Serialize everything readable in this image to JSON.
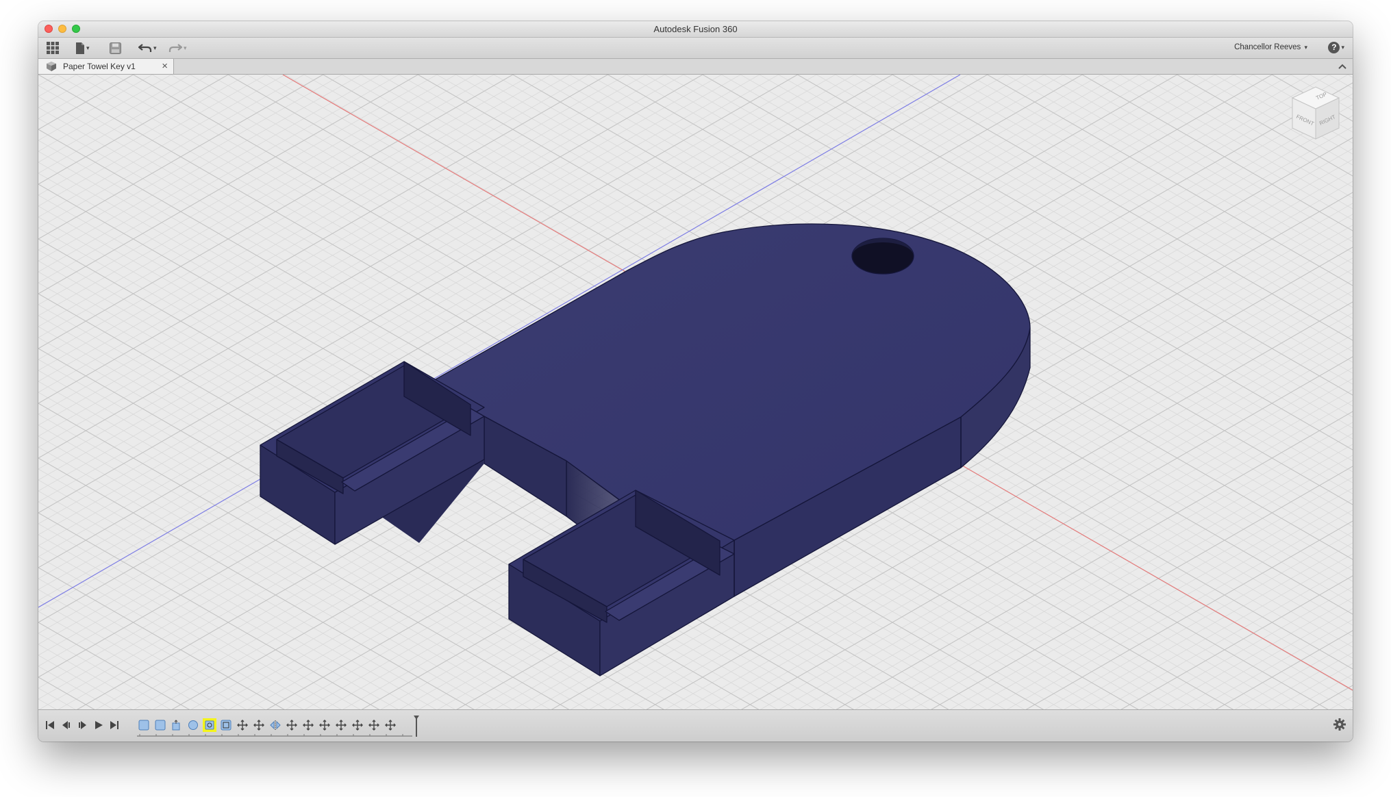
{
  "window": {
    "title": "Autodesk Fusion 360"
  },
  "toolbar": {
    "user_name": "Chancellor Reeves"
  },
  "document_tab": {
    "label": "Paper Towel Key v1",
    "close_glyph": "×"
  },
  "help": {
    "glyph": "?"
  },
  "viewcube": {
    "faces": [
      "TOP",
      "FRONT",
      "RIGHT"
    ]
  },
  "colors": {
    "model_top": "#36376a",
    "model_side": "#2e2f5c",
    "grid_bg": "#ebebeb",
    "axis_red": "#e26a6a",
    "axis_blue": "#6a6ade",
    "active_feature_highlight": "#f4f41c"
  },
  "timeline": {
    "controls": [
      "first-frame-icon",
      "step-back-icon",
      "step-forward-icon",
      "play-icon",
      "last-frame-icon"
    ],
    "features": [
      "sketch",
      "sketch",
      "extrude",
      "sketch",
      "extrude-active",
      "sketch",
      "move",
      "move",
      "mirror",
      "move",
      "move",
      "move",
      "move",
      "move",
      "move"
    ],
    "active_feature_index": 4
  }
}
